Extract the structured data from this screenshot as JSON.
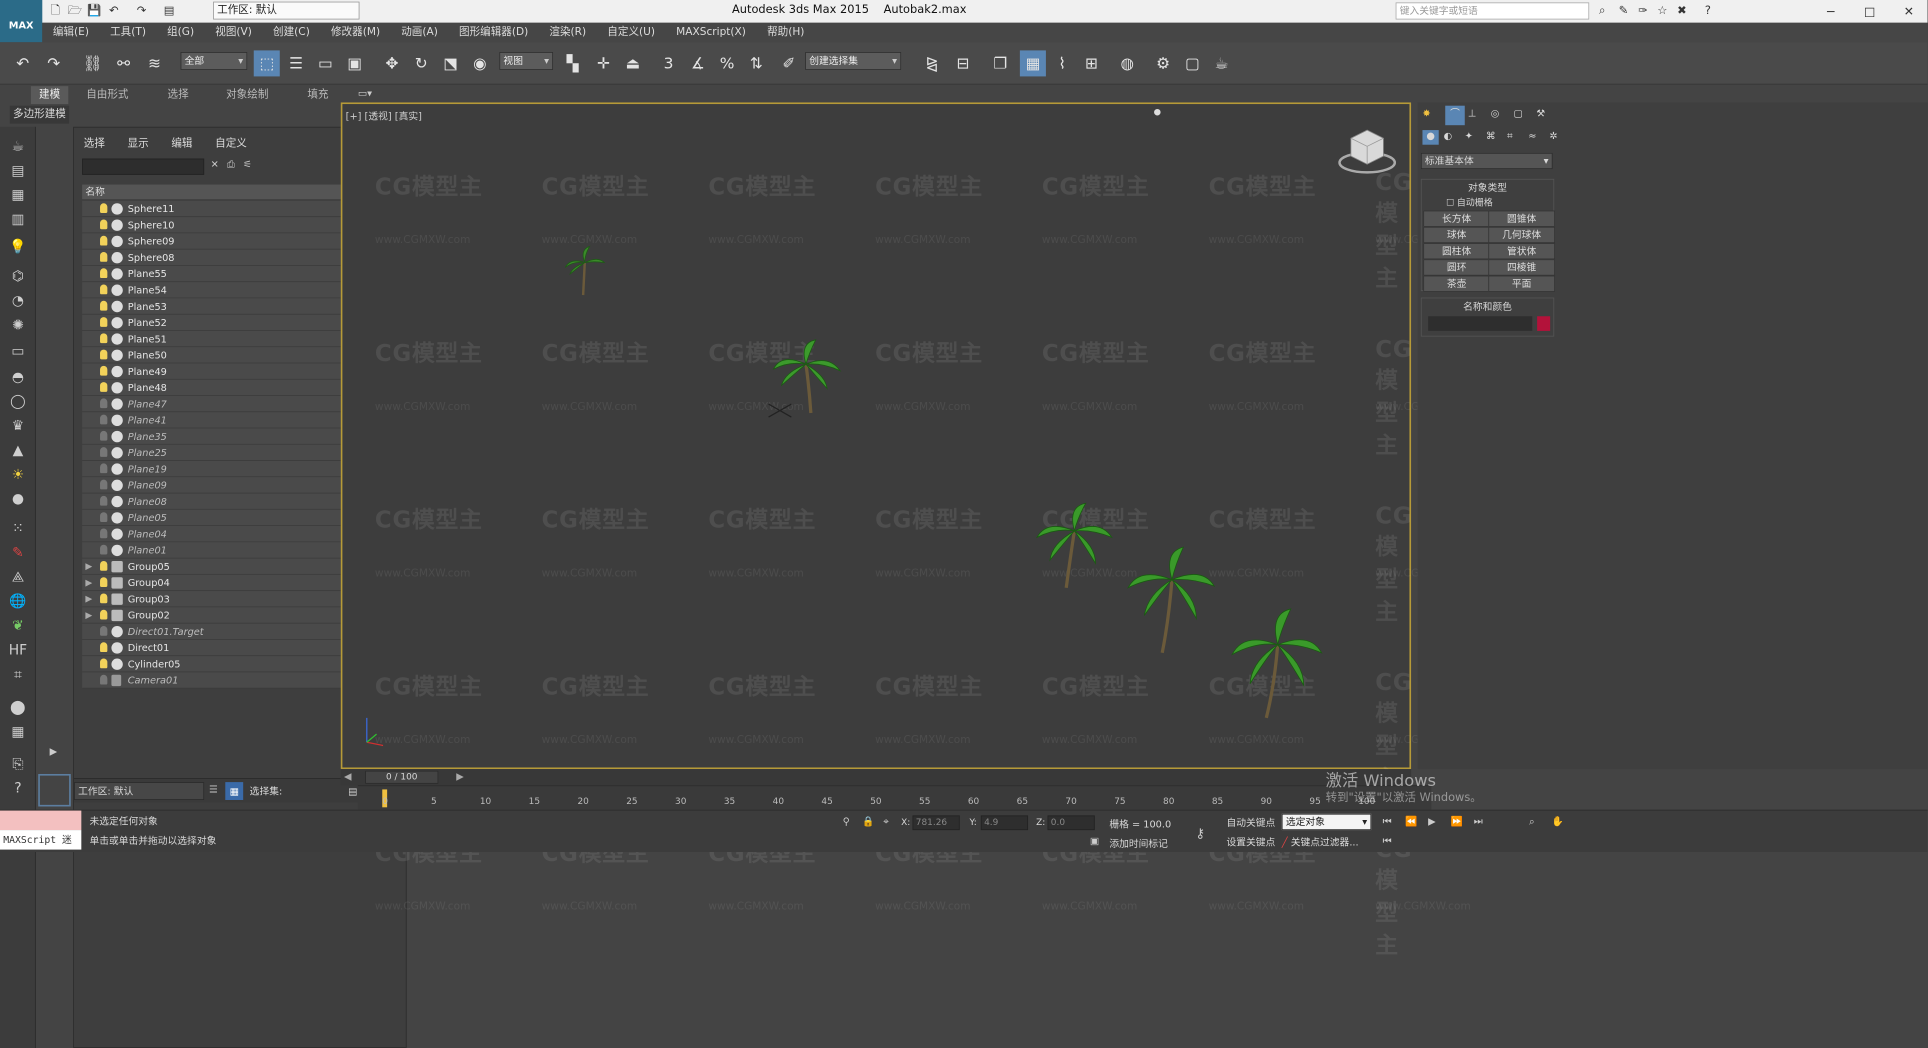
{
  "window": {
    "app_title": "Autodesk 3ds Max  2015",
    "file_name": "Autobak2.max",
    "workspace": "工作区: 默认",
    "search_placeholder": "键入关键字或短语",
    "min": "−",
    "max": "□",
    "close": "✕"
  },
  "logo": {
    "text": "MAX"
  },
  "menu": [
    "编辑(E)",
    "工具(T)",
    "组(G)",
    "视图(V)",
    "创建(C)",
    "修改器(M)",
    "动画(A)",
    "图形编辑器(D)",
    "渲染(R)",
    "自定义(U)",
    "MAXScript(X)",
    "帮助(H)"
  ],
  "toolbar": {
    "selection_filter": "全部",
    "ref_coord": "视图",
    "named_selection": "创建选择集",
    "snap_label": "3"
  },
  "ribbon": {
    "tabs": [
      "建模",
      "自由形式",
      "选择",
      "对象绘制",
      "填充"
    ],
    "active_sub": "多边形建模"
  },
  "explorer": {
    "menu": [
      "选择",
      "显示",
      "编辑",
      "自定义"
    ],
    "name_header": "名称",
    "objects": [
      {
        "name": "Sphere11",
        "type": "sphere",
        "hidden": false
      },
      {
        "name": "Sphere10",
        "type": "sphere",
        "hidden": false
      },
      {
        "name": "Sphere09",
        "type": "sphere",
        "hidden": false
      },
      {
        "name": "Sphere08",
        "type": "sphere",
        "hidden": false
      },
      {
        "name": "Plane55",
        "type": "sphere",
        "hidden": false
      },
      {
        "name": "Plane54",
        "type": "sphere",
        "hidden": false
      },
      {
        "name": "Plane53",
        "type": "sphere",
        "hidden": false
      },
      {
        "name": "Plane52",
        "type": "sphere",
        "hidden": false
      },
      {
        "name": "Plane51",
        "type": "sphere",
        "hidden": false
      },
      {
        "name": "Plane50",
        "type": "sphere",
        "hidden": false
      },
      {
        "name": "Plane49",
        "type": "sphere",
        "hidden": false
      },
      {
        "name": "Plane48",
        "type": "sphere",
        "hidden": false
      },
      {
        "name": "Plane47",
        "type": "sphere",
        "hidden": true
      },
      {
        "name": "Plane41",
        "type": "sphere",
        "hidden": true
      },
      {
        "name": "Plane35",
        "type": "sphere",
        "hidden": true
      },
      {
        "name": "Plane25",
        "type": "sphere",
        "hidden": true
      },
      {
        "name": "Plane19",
        "type": "sphere",
        "hidden": true
      },
      {
        "name": "Plane09",
        "type": "sphere",
        "hidden": true
      },
      {
        "name": "Plane08",
        "type": "sphere",
        "hidden": true
      },
      {
        "name": "Plane05",
        "type": "sphere",
        "hidden": true
      },
      {
        "name": "Plane04",
        "type": "sphere",
        "hidden": true
      },
      {
        "name": "Plane01",
        "type": "sphere",
        "hidden": true
      },
      {
        "name": "Group05",
        "type": "group",
        "hidden": false,
        "expandable": true
      },
      {
        "name": "Group04",
        "type": "group",
        "hidden": false,
        "expandable": true
      },
      {
        "name": "Group03",
        "type": "group",
        "hidden": false,
        "expandable": true
      },
      {
        "name": "Group02",
        "type": "group",
        "hidden": false,
        "expandable": true
      },
      {
        "name": "Direct01.Target",
        "type": "light",
        "hidden": true
      },
      {
        "name": "Direct01",
        "type": "light",
        "hidden": false
      },
      {
        "name": "Cylinder05",
        "type": "sphere",
        "hidden": false
      },
      {
        "name": "Camera01",
        "type": "camera",
        "hidden": true
      }
    ],
    "workspace": "工作区: 默认",
    "selection_set": "选择集:"
  },
  "viewport": {
    "label": "[+] [透视] [真实]",
    "watermark": "CG模型主",
    "watermark_url": "www.CGMXW.com"
  },
  "command_panel": {
    "dropdown": "标准基本体",
    "rollout_object_type": "对象类型",
    "auto_grid": "自动栅格",
    "buttons": [
      "长方体",
      "圆锥体",
      "球体",
      "几何球体",
      "圆柱体",
      "管状体",
      "圆环",
      "四棱锥",
      "茶壶",
      "平面"
    ],
    "rollout_name_color": "名称和颜色",
    "accent_color": "#b3123a"
  },
  "timeline": {
    "frame": "0 / 100",
    "ticks": [
      "0",
      "5",
      "10",
      "15",
      "20",
      "25",
      "30",
      "35",
      "40",
      "45",
      "50",
      "55",
      "60",
      "65",
      "70",
      "75",
      "80",
      "85",
      "90",
      "95",
      "100"
    ]
  },
  "status": {
    "maxscript": "MAXScript 迷",
    "line1": "未选定任何对象",
    "line2": "单击或单击并拖动以选择对象",
    "x_label": "X:",
    "x": "781.26",
    "y_label": "Y:",
    "y": "4.9",
    "z_label": "Z:",
    "z": "0.0",
    "grid": "栅格 = 100.0",
    "auto_key": "自动关键点",
    "set_key": "设置关键点",
    "selected_object": "选定对象",
    "key_filters": "关键点过滤器...",
    "add_time_tag": "添加时间标记"
  },
  "activation": {
    "title": "激活 Windows",
    "sub": "转到\"设置\"以激活 Windows。"
  }
}
